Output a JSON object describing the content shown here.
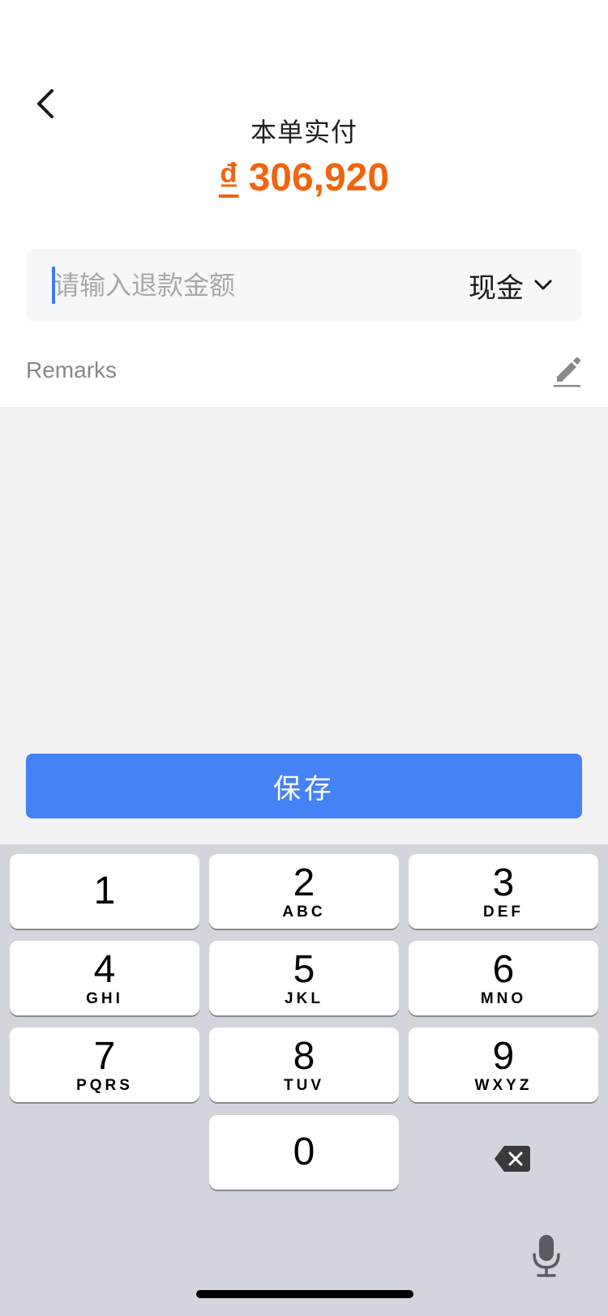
{
  "header": {
    "title": "本单实付",
    "currency_symbol": "₫",
    "amount": "306,920",
    "back_icon": "chevron-left-icon",
    "amount_color": "#f0640f"
  },
  "refund_input": {
    "placeholder": "请输入退款金额",
    "value": "",
    "payment_method": "现金",
    "dropdown_icon": "chevron-down-icon"
  },
  "remarks": {
    "label": "Remarks",
    "edit_icon": "pencil-icon"
  },
  "actions": {
    "save_label": "保存",
    "save_color": "#4582f6"
  },
  "keypad": {
    "keys": [
      {
        "digit": "1",
        "letters": ""
      },
      {
        "digit": "2",
        "letters": "ABC"
      },
      {
        "digit": "3",
        "letters": "DEF"
      },
      {
        "digit": "4",
        "letters": "GHI"
      },
      {
        "digit": "5",
        "letters": "JKL"
      },
      {
        "digit": "6",
        "letters": "MNO"
      },
      {
        "digit": "7",
        "letters": "PQRS"
      },
      {
        "digit": "8",
        "letters": "TUV"
      },
      {
        "digit": "9",
        "letters": "WXYZ"
      },
      {
        "digit": "0",
        "letters": ""
      }
    ],
    "backspace_icon": "backspace-icon",
    "mic_icon": "microphone-icon"
  }
}
